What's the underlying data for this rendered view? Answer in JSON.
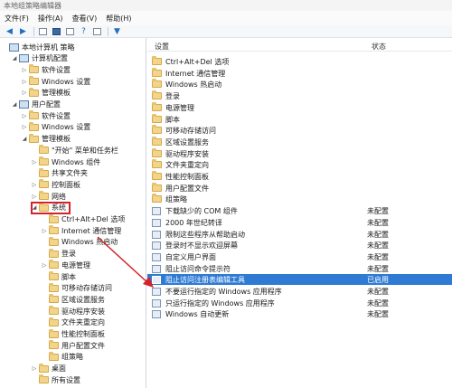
{
  "window": {
    "title": "本地组策略编辑器"
  },
  "menu": [
    "文件(F)",
    "操作(A)",
    "查看(V)",
    "帮助(H)"
  ],
  "tree": [
    {
      "label": "本地计算机 策略",
      "level": 0,
      "icon": "computer-icon",
      "arrow": ""
    },
    {
      "label": "计算机配置",
      "level": 1,
      "icon": "computer-icon",
      "arrow": "◢"
    },
    {
      "label": "软件设置",
      "level": 2,
      "icon": "folder-icon",
      "arrow": "▷"
    },
    {
      "label": "Windows 设置",
      "level": 2,
      "icon": "folder-icon",
      "arrow": "▷"
    },
    {
      "label": "管理模板",
      "level": 2,
      "icon": "folder-icon",
      "arrow": "▷"
    },
    {
      "label": "用户配置",
      "level": 1,
      "icon": "computer-icon",
      "arrow": "◢"
    },
    {
      "label": "软件设置",
      "level": 2,
      "icon": "folder-icon",
      "arrow": "▷"
    },
    {
      "label": "Windows 设置",
      "level": 2,
      "icon": "folder-icon",
      "arrow": "▷"
    },
    {
      "label": "管理模板",
      "level": 2,
      "icon": "folder-icon",
      "arrow": "◢"
    },
    {
      "label": "\"开始\" 菜单和任务栏",
      "level": 3,
      "icon": "folder-icon",
      "arrow": ""
    },
    {
      "label": "Windows 组件",
      "level": 3,
      "icon": "folder-icon",
      "arrow": "▷"
    },
    {
      "label": "共享文件夹",
      "level": 3,
      "icon": "folder-icon",
      "arrow": ""
    },
    {
      "label": "控制面板",
      "level": 3,
      "icon": "folder-icon",
      "arrow": "▷"
    },
    {
      "label": "网络",
      "level": 3,
      "icon": "folder-icon",
      "arrow": "▷"
    },
    {
      "label": "系统",
      "level": 3,
      "icon": "folder-icon",
      "arrow": "◢"
    },
    {
      "label": "Ctrl+Alt+Del 选项",
      "level": 4,
      "icon": "folder-icon",
      "arrow": ""
    },
    {
      "label": "Internet 通信管理",
      "level": 4,
      "icon": "folder-icon",
      "arrow": "▷"
    },
    {
      "label": "Windows 热启动",
      "level": 4,
      "icon": "folder-icon",
      "arrow": ""
    },
    {
      "label": "登录",
      "level": 4,
      "icon": "folder-icon",
      "arrow": ""
    },
    {
      "label": "电源管理",
      "level": 4,
      "icon": "folder-icon",
      "arrow": "▷"
    },
    {
      "label": "脚本",
      "level": 4,
      "icon": "folder-icon",
      "arrow": ""
    },
    {
      "label": "可移动存储访问",
      "level": 4,
      "icon": "folder-icon",
      "arrow": ""
    },
    {
      "label": "区域设置服务",
      "level": 4,
      "icon": "folder-icon",
      "arrow": ""
    },
    {
      "label": "驱动程序安装",
      "level": 4,
      "icon": "folder-icon",
      "arrow": ""
    },
    {
      "label": "文件夹重定向",
      "level": 4,
      "icon": "folder-icon",
      "arrow": ""
    },
    {
      "label": "性能控制面板",
      "level": 4,
      "icon": "folder-icon",
      "arrow": ""
    },
    {
      "label": "用户配置文件",
      "level": 4,
      "icon": "folder-icon",
      "arrow": ""
    },
    {
      "label": "组策略",
      "level": 4,
      "icon": "folder-icon",
      "arrow": ""
    },
    {
      "label": "桌面",
      "level": 3,
      "icon": "folder-icon",
      "arrow": "▷"
    },
    {
      "label": "所有设置",
      "level": 3,
      "icon": "folder-icon",
      "arrow": ""
    }
  ],
  "list": {
    "col_setting": "设置",
    "col_status": "状态",
    "rows": [
      {
        "name": "Ctrl+Alt+Del 选项",
        "status": "",
        "icon": "folder-icon"
      },
      {
        "name": "Internet 通信管理",
        "status": "",
        "icon": "folder-icon"
      },
      {
        "name": "Windows 热启动",
        "status": "",
        "icon": "folder-icon"
      },
      {
        "name": "登录",
        "status": "",
        "icon": "folder-icon"
      },
      {
        "name": "电源管理",
        "status": "",
        "icon": "folder-icon"
      },
      {
        "name": "脚本",
        "status": "",
        "icon": "folder-icon"
      },
      {
        "name": "可移动存储访问",
        "status": "",
        "icon": "folder-icon"
      },
      {
        "name": "区域设置服务",
        "status": "",
        "icon": "folder-icon"
      },
      {
        "name": "驱动程序安装",
        "status": "",
        "icon": "folder-icon"
      },
      {
        "name": "文件夹重定向",
        "status": "",
        "icon": "folder-icon"
      },
      {
        "name": "性能控制面板",
        "status": "",
        "icon": "folder-icon"
      },
      {
        "name": "用户配置文件",
        "status": "",
        "icon": "folder-icon"
      },
      {
        "name": "组策略",
        "status": "",
        "icon": "folder-icon"
      },
      {
        "name": "下载缺少的 COM 组件",
        "status": "未配置",
        "icon": "policy-icon"
      },
      {
        "name": "2000 年世纪转译",
        "status": "未配置",
        "icon": "policy-icon"
      },
      {
        "name": "限制这些程序从帮助启动",
        "status": "未配置",
        "icon": "policy-icon"
      },
      {
        "name": "登录时不显示欢迎屏幕",
        "status": "未配置",
        "icon": "policy-icon"
      },
      {
        "name": "自定义用户界面",
        "status": "未配置",
        "icon": "policy-icon"
      },
      {
        "name": "阻止访问命令提示符",
        "status": "未配置",
        "icon": "policy-icon"
      },
      {
        "name": "阻止访问注册表编辑工具",
        "status": "已启用",
        "icon": "policy-icon",
        "selected": true
      },
      {
        "name": "不要运行指定的 Windows 应用程序",
        "status": "未配置",
        "icon": "policy-icon"
      },
      {
        "name": "只运行指定的 Windows 应用程序",
        "status": "未配置",
        "icon": "policy-icon"
      },
      {
        "name": "Windows 自动更新",
        "status": "未配置",
        "icon": "policy-icon"
      }
    ]
  },
  "colors": {
    "selection": "#2f7bd4",
    "annotation": "#d2232a",
    "folder": "#f2d48a"
  }
}
